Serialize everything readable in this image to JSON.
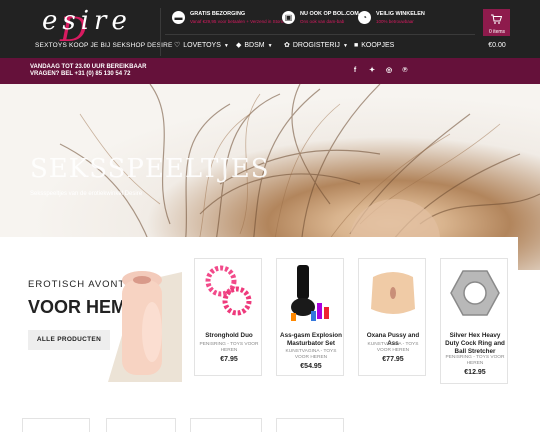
{
  "header": {
    "logo_text": "esire",
    "logo_initial": "D",
    "tagline": "SEXTOYS KOOP JE BIJ SEKSHOP DESIRE",
    "usps": [
      {
        "title": "GRATIS BEZORGING",
        "subtitle": "Vanaf €29,95 voor betaalen + Verzend in Stom!",
        "icon": "truck-icon"
      },
      {
        "title": "NU OOK OP BOL.COM",
        "subtitle": "Ons ook van dam-bab",
        "icon": "gift-icon"
      },
      {
        "title": "VEILIG WINKELEN",
        "subtitle": "100% betrouwbaar",
        "icon": "clock-icon"
      }
    ],
    "nav": [
      {
        "label": "LOVETOYS",
        "icon": "heart-icon"
      },
      {
        "label": "BDSM",
        "icon": "diamond-icon"
      },
      {
        "label": "DROGISTERIJ",
        "icon": "pills-icon"
      },
      {
        "label": "KOOPJES",
        "icon": "gift-icon"
      }
    ],
    "cart": {
      "count": "0 items",
      "total": "€0.00",
      "color": "#8e1b4c"
    }
  },
  "topbar": {
    "line1": "VANDAAG TOT 23.00 UUR BEREIKBAAR",
    "line2": "VRAGEN? BEL +31 (0) 85 130 54 72",
    "socials": [
      "facebook-icon",
      "twitter-icon",
      "instagram-icon",
      "pinterest-icon"
    ],
    "color": "#65113a"
  },
  "hero": {
    "title": "SEKSSPEELTJES",
    "breadcrumb": "Seksspeeltjes van de erotiekwinkel Desire"
  },
  "promo": {
    "small": "EROTISCH AVONTUUR",
    "big": "VOOR HEM",
    "button": "ALLE PRODUCTEN"
  },
  "products": [
    {
      "name": "Stronghold Duo",
      "category": "PENISRING - TOYS VOOR HEREN",
      "price": "€7.95"
    },
    {
      "name": "Ass-gasm Explosion Masturbator Set",
      "category": "KUNSTVAGINA - TOYS VOOR HEREN",
      "price": "€54.95"
    },
    {
      "name": "Oxana Pussy and Ass",
      "category": "KUNSTVAGINA - TOYS VOOR HEREN",
      "price": "€77.95"
    },
    {
      "name": "Silver Hex Heavy Duty Cock Ring and Ball Stretcher",
      "category": "PENISRING - TOYS VOOR HEREN",
      "price": "€12.95"
    }
  ],
  "colors": {
    "accent": "#d81b60",
    "dark": "#222222"
  }
}
